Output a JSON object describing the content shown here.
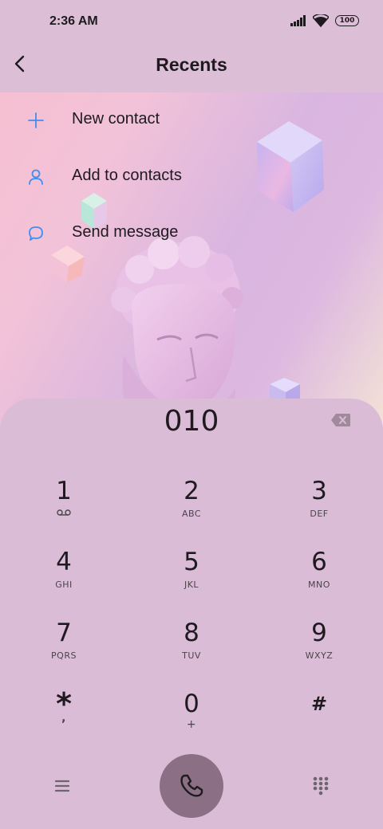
{
  "status_bar": {
    "time": "2:36 AM",
    "battery": "100",
    "icons": [
      "signal-icon",
      "wifi-icon",
      "battery-icon"
    ]
  },
  "header": {
    "title": "Recents",
    "back_icon": "back-arrow-icon"
  },
  "actions": [
    {
      "label": "New contact",
      "icon": "plus-icon"
    },
    {
      "label": "Add to contacts",
      "icon": "person-icon"
    },
    {
      "label": "Send message",
      "icon": "message-bubble-icon"
    }
  ],
  "dialer": {
    "number": "010",
    "keys": [
      {
        "digit": "1",
        "letters": ""
      },
      {
        "digit": "2",
        "letters": "ABC"
      },
      {
        "digit": "3",
        "letters": "DEF"
      },
      {
        "digit": "4",
        "letters": "GHI"
      },
      {
        "digit": "5",
        "letters": "JKL"
      },
      {
        "digit": "6",
        "letters": "MNO"
      },
      {
        "digit": "7",
        "letters": "PQRS"
      },
      {
        "digit": "8",
        "letters": "TUV"
      },
      {
        "digit": "9",
        "letters": "WXYZ"
      },
      {
        "digit": "*",
        "letters": ","
      },
      {
        "digit": "0",
        "letters": "+"
      },
      {
        "digit": "#",
        "letters": ""
      }
    ]
  },
  "colors": {
    "accent": "#3f8ef0",
    "call_button": "#8b6f84",
    "panel": "#dbbcd6"
  }
}
